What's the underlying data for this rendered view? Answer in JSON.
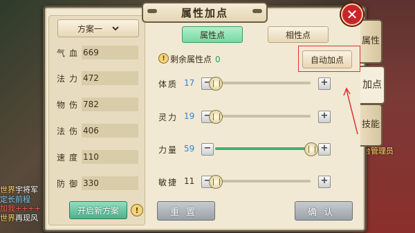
{
  "window": {
    "title": "属性加点",
    "close_label": "✕"
  },
  "scheme": {
    "selected": "方案一",
    "dropdown_icon": "chevron-down-icon"
  },
  "stats": [
    {
      "label": "气血",
      "value": "669"
    },
    {
      "label": "法力",
      "value": "472"
    },
    {
      "label": "物伤",
      "value": "782"
    },
    {
      "label": "法伤",
      "value": "406"
    },
    {
      "label": "速度",
      "value": "110"
    },
    {
      "label": "防御",
      "value": "330"
    }
  ],
  "left_footer": {
    "new_plan_label": "开启新方案",
    "info_icon": "!"
  },
  "tabs": {
    "attr_points": "属性点",
    "affinity_points": "相性点"
  },
  "remaining": {
    "label": "剩余属性点",
    "value": "0",
    "icon": "!"
  },
  "auto_add_label": "自动加点",
  "attributes": [
    {
      "label": "体质",
      "value": "17",
      "progress": 0.0
    },
    {
      "label": "灵力",
      "value": "19",
      "progress": 0.0
    },
    {
      "label": "力量",
      "value": "59",
      "progress": 1.0
    },
    {
      "label": "敏捷",
      "value": "11",
      "progress": 0.0
    }
  ],
  "buttons": {
    "reset": "重置",
    "confirm": "确认",
    "minus": "−",
    "plus": "+"
  },
  "side_tabs": [
    {
      "label": "属性",
      "active": false
    },
    {
      "label": "加点",
      "active": true
    },
    {
      "label": "技能",
      "active": false
    }
  ],
  "background": {
    "chat": [
      {
        "tag": "世界",
        "text": "宇将军"
      },
      {
        "tag": "",
        "text": "定长前程"
      },
      {
        "tag": "",
        "text": "加我++++"
      },
      {
        "tag": "世界",
        "text": "再现风"
      }
    ],
    "manager_label": "台管理员"
  },
  "colors": {
    "accent_green": "#3fb36b",
    "highlight_red": "#e03030",
    "close_red": "#c8252a"
  }
}
